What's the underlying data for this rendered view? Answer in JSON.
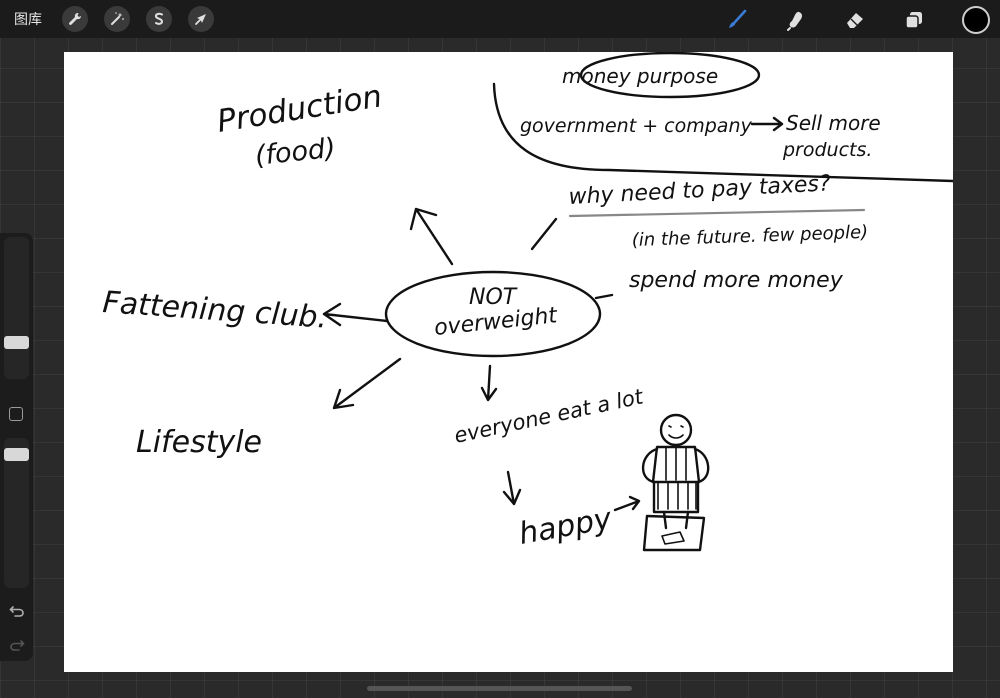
{
  "toolbar": {
    "gallery_label": "图库"
  },
  "sketch": {
    "production": "Production",
    "food": "(food)",
    "money_purpose": "money purpose",
    "gov_company": "government + company",
    "sell_more": "Sell more",
    "products": "products.",
    "why_taxes": "why need to pay taxes?",
    "future_few": "(in the future. few people)",
    "spend_more": "spend more money",
    "fattening": "Fattening club.",
    "center_line1": "NOT",
    "center_line2": "overweight",
    "everyone_eat": "everyone eat a lot",
    "lifestyle": "Lifestyle",
    "happy": "happy"
  },
  "colors": {
    "accent_brush": "#3a7bd5",
    "current_color": "#000000"
  }
}
